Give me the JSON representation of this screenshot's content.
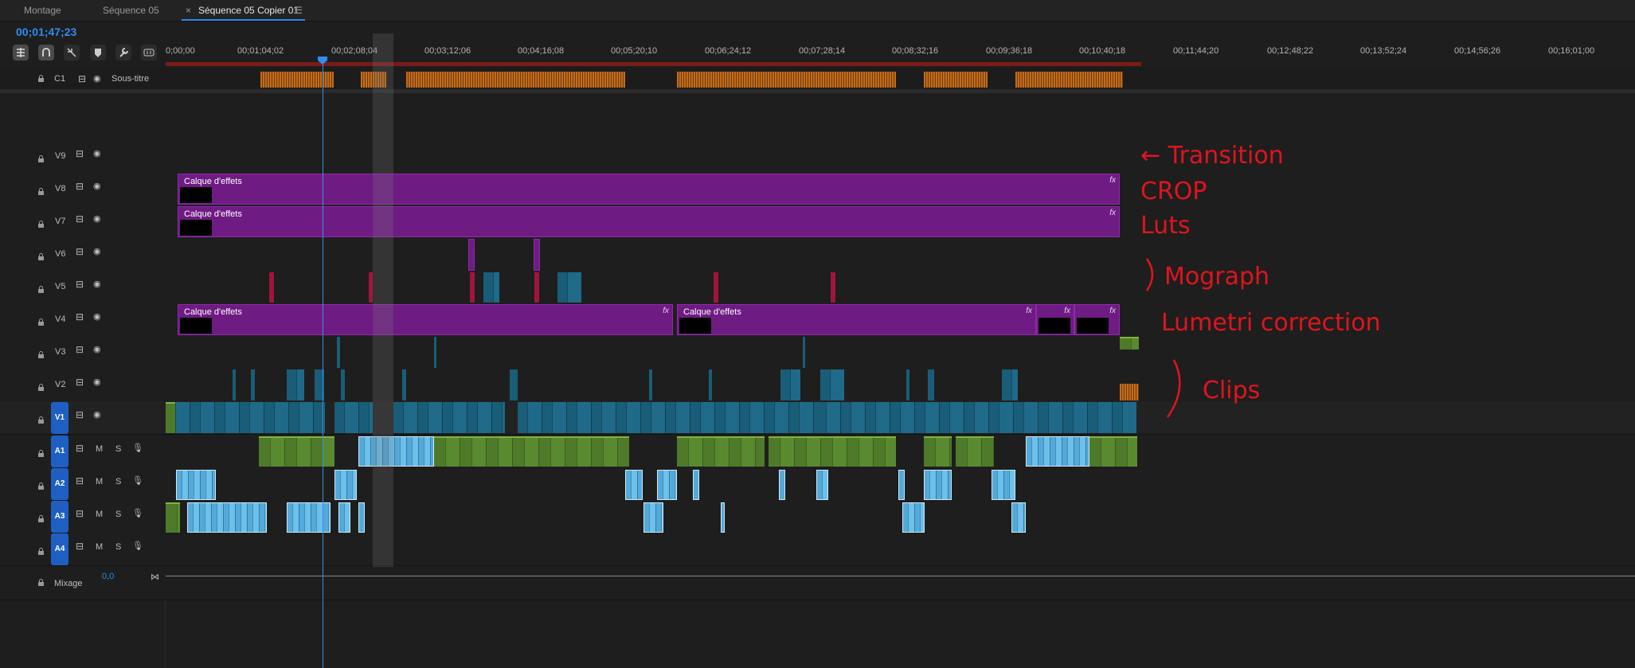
{
  "tabs": [
    "Montage",
    "Séquence 05",
    "Séquence 05 Copier 01"
  ],
  "tab_close": "×",
  "tab_menu": "☰",
  "timecode": "00;01;47;23",
  "ruler_labels": [
    "0;00;00",
    "00;01;04;02",
    "00;02;08;04",
    "00;03;12;06",
    "00;04;16;08",
    "00;05;20;10",
    "00;06;24;12",
    "00;07;28;14",
    "00;08;32;16",
    "00;09;36;18",
    "00;10;40;18",
    "00;11;44;20",
    "00;12;48;22",
    "00;13;52;24",
    "00;14;56;26",
    "00;16;01;00"
  ],
  "tools": [
    "insert-tool",
    "snap-tool",
    "linked-selection-tool",
    "marker-tool",
    "wrench-tool",
    "captions-tool"
  ],
  "caption_track": {
    "name": "C1",
    "label": "Sous-titre"
  },
  "video_tracks": [
    "V9",
    "V8",
    "V7",
    "V6",
    "V5",
    "V4",
    "V3",
    "V2",
    "V1"
  ],
  "audio_tracks": [
    "A1",
    "A2",
    "A3",
    "A4"
  ],
  "audio_buttons": {
    "mute": "M",
    "solo": "S"
  },
  "mix": {
    "label": "Mixage",
    "value": "0,0"
  },
  "clip_label": "Calque d'effets",
  "fx": "fx",
  "annotations": [
    "← Transition",
    "CROP",
    "Luts",
    "Mograph",
    "Lumetri correction",
    "Clips"
  ],
  "colors": {
    "accent": "#2f8df0",
    "adjustment_layer": "#6f1b84",
    "video_clip": "#1a5d78",
    "audio_clip_green": "#4f7a2a",
    "audio_clip_blue": "#54a9d8",
    "annotation": "#e0141e"
  }
}
